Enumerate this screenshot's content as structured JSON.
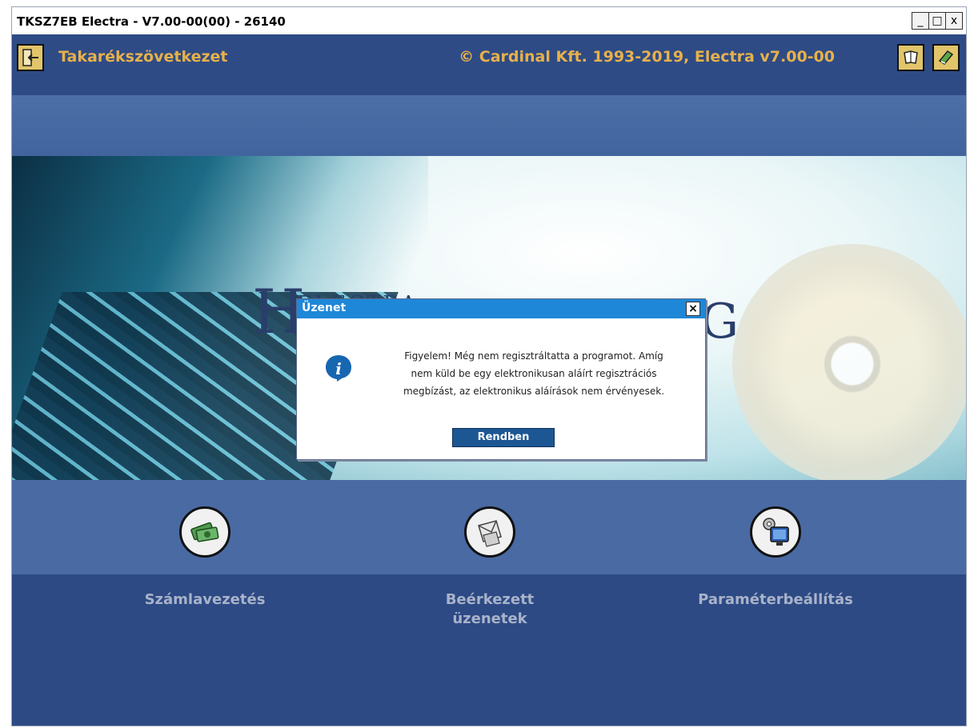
{
  "window": {
    "title": "TKSZ7EB Electra - V7.00-00(00) - 26140",
    "controls": {
      "minimize": "_",
      "maximize": "□",
      "close": "x"
    }
  },
  "header": {
    "organization": "Takarékszövetkezet",
    "copyright": "© Cardinal Kft. 1993-2019, Electra v7.00-00",
    "buttons": [
      {
        "name": "exit",
        "icon": "exit-door-icon"
      },
      {
        "name": "help",
        "icon": "book-icon"
      },
      {
        "name": "manual",
        "icon": "green-book-icon"
      }
    ]
  },
  "hero": {
    "logo_left": "H",
    "logo_small": "ELECTRA",
    "logo_right": "G"
  },
  "modules": [
    {
      "label": "Számlavezetés",
      "icon": "money-icon"
    },
    {
      "label": "Beérkezett üzenetek",
      "icon": "envelope-icon"
    },
    {
      "label": "Paraméterbeállítás",
      "icon": "settings-monitor-icon"
    }
  ],
  "dialog": {
    "title": "Üzenet",
    "close_label": "×",
    "message_lines": [
      "Figyelem! Még nem regisztráltatta a programot. Amíg",
      "nem küld be egy elektronikusan aláírt regisztrációs",
      "megbízást, az elektronikus aláírások nem érvényesek."
    ],
    "ok_label": "Rendben",
    "icon": "info-icon"
  },
  "colors": {
    "accent_text": "#e7b14a",
    "app_background": "#2e4b86",
    "dialog_titlebar": "#1e87d8",
    "ok_button": "#1d5793"
  }
}
